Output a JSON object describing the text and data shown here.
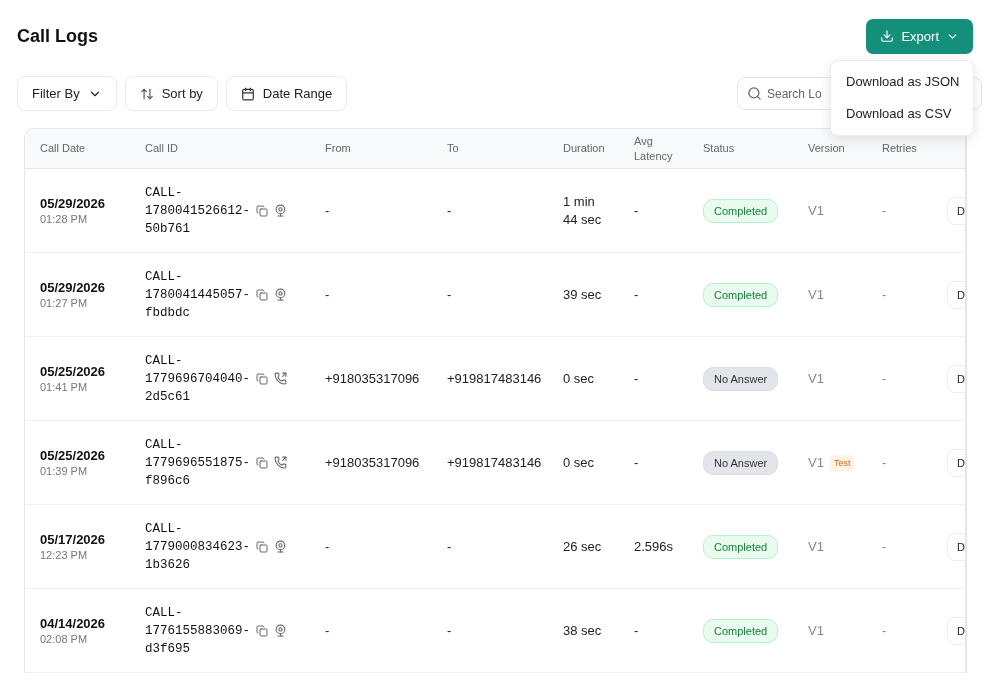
{
  "title": "Call Logs",
  "export": {
    "label": "Export",
    "menu": [
      "Download as JSON",
      "Download as CSV"
    ]
  },
  "toolbar": [
    {
      "kind": "filter",
      "label": "Filter By"
    },
    {
      "kind": "sort",
      "label": "Sort by"
    },
    {
      "kind": "date",
      "label": "Date Range"
    }
  ],
  "search": {
    "placeholder": "Search Lo"
  },
  "table": {
    "columns": [
      "Call Date",
      "Call ID",
      "From",
      "To",
      "Duration",
      "Avg Latency",
      "Status",
      "Version",
      "Retries"
    ],
    "rows": [
      {
        "date": "05/29/2026",
        "time": "01:28 PM",
        "call_id": "CALL-\n1780041526612-\n50b761",
        "kind": "web",
        "from": "-",
        "to": "-",
        "duration": "1 min 44 sec",
        "latency": "-",
        "status": {
          "kind": "completed",
          "label": "Completed"
        },
        "version": "V1",
        "retries": "-",
        "action": "D"
      },
      {
        "date": "05/29/2026",
        "time": "01:27 PM",
        "call_id": "CALL-\n1780041445057-\nfbdbdc",
        "kind": "web",
        "from": "-",
        "to": "-",
        "duration": "39 sec",
        "latency": "-",
        "status": {
          "kind": "completed",
          "label": "Completed"
        },
        "version": "V1",
        "retries": "-",
        "action": "D"
      },
      {
        "date": "05/25/2026",
        "time": "01:41 PM",
        "call_id": "CALL-\n1779696704040-\n2d5c61",
        "kind": "phone",
        "from": "+918035317096",
        "to": "+919817483146",
        "duration": "0 sec",
        "latency": "-",
        "status": {
          "kind": "no_answer",
          "label": "No Answer"
        },
        "version": "V1",
        "retries": "-",
        "action": "D"
      },
      {
        "date": "05/25/2026",
        "time": "01:39 PM",
        "call_id": "CALL-\n1779696551875-\nf896c6",
        "kind": "phone",
        "from": "+918035317096",
        "to": "+919817483146",
        "duration": "0 sec",
        "latency": "-",
        "status": {
          "kind": "no_answer",
          "label": "No Answer"
        },
        "version": "V1",
        "tag": "Test",
        "retries": "-",
        "action": "D"
      },
      {
        "date": "05/17/2026",
        "time": "12:23 PM",
        "call_id": "CALL-\n1779000834623-\n1b3626",
        "kind": "web",
        "from": "-",
        "to": "-",
        "duration": "26 sec",
        "latency": "2.596s",
        "status": {
          "kind": "completed",
          "label": "Completed"
        },
        "version": "V1",
        "retries": "-",
        "action": "D"
      },
      {
        "date": "04/14/2026",
        "time": "02:08 PM",
        "call_id": "CALL-\n1776155883069-\nd3f695",
        "kind": "web",
        "from": "-",
        "to": "-",
        "duration": "38 sec",
        "latency": "-",
        "status": {
          "kind": "completed",
          "label": "Completed"
        },
        "version": "V1",
        "retries": "-",
        "action": "D"
      }
    ]
  }
}
